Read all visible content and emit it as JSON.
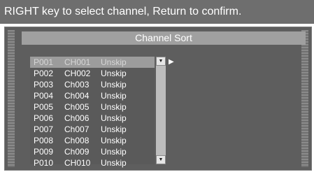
{
  "hint": "RIGHT key to select channel, Return to confirm.",
  "dialog": {
    "title": "Channel Sort"
  },
  "channels": [
    {
      "prog": "P001",
      "name": "CH001",
      "status": "Unskip"
    },
    {
      "prog": "P002",
      "name": "CH002",
      "status": "Unskip"
    },
    {
      "prog": "P003",
      "name": "Ch003",
      "status": "Unskip"
    },
    {
      "prog": "P004",
      "name": "Ch004",
      "status": "Unskip"
    },
    {
      "prog": "P005",
      "name": "Ch005",
      "status": "Unskip"
    },
    {
      "prog": "P006",
      "name": "Ch006",
      "status": "Unskip"
    },
    {
      "prog": "P007",
      "name": "Ch007",
      "status": "Unskip"
    },
    {
      "prog": "P008",
      "name": "Ch008",
      "status": "Unskip"
    },
    {
      "prog": "P009",
      "name": "Ch009",
      "status": "Unskip"
    },
    {
      "prog": "P010",
      "name": "CH010",
      "status": "Unskip"
    }
  ],
  "selected_index": 0,
  "icons": {
    "scroll_up": "dropdown-arrow-icon",
    "scroll_down": "dropdown-arrow-icon",
    "pointer": "right-pointer-icon"
  }
}
